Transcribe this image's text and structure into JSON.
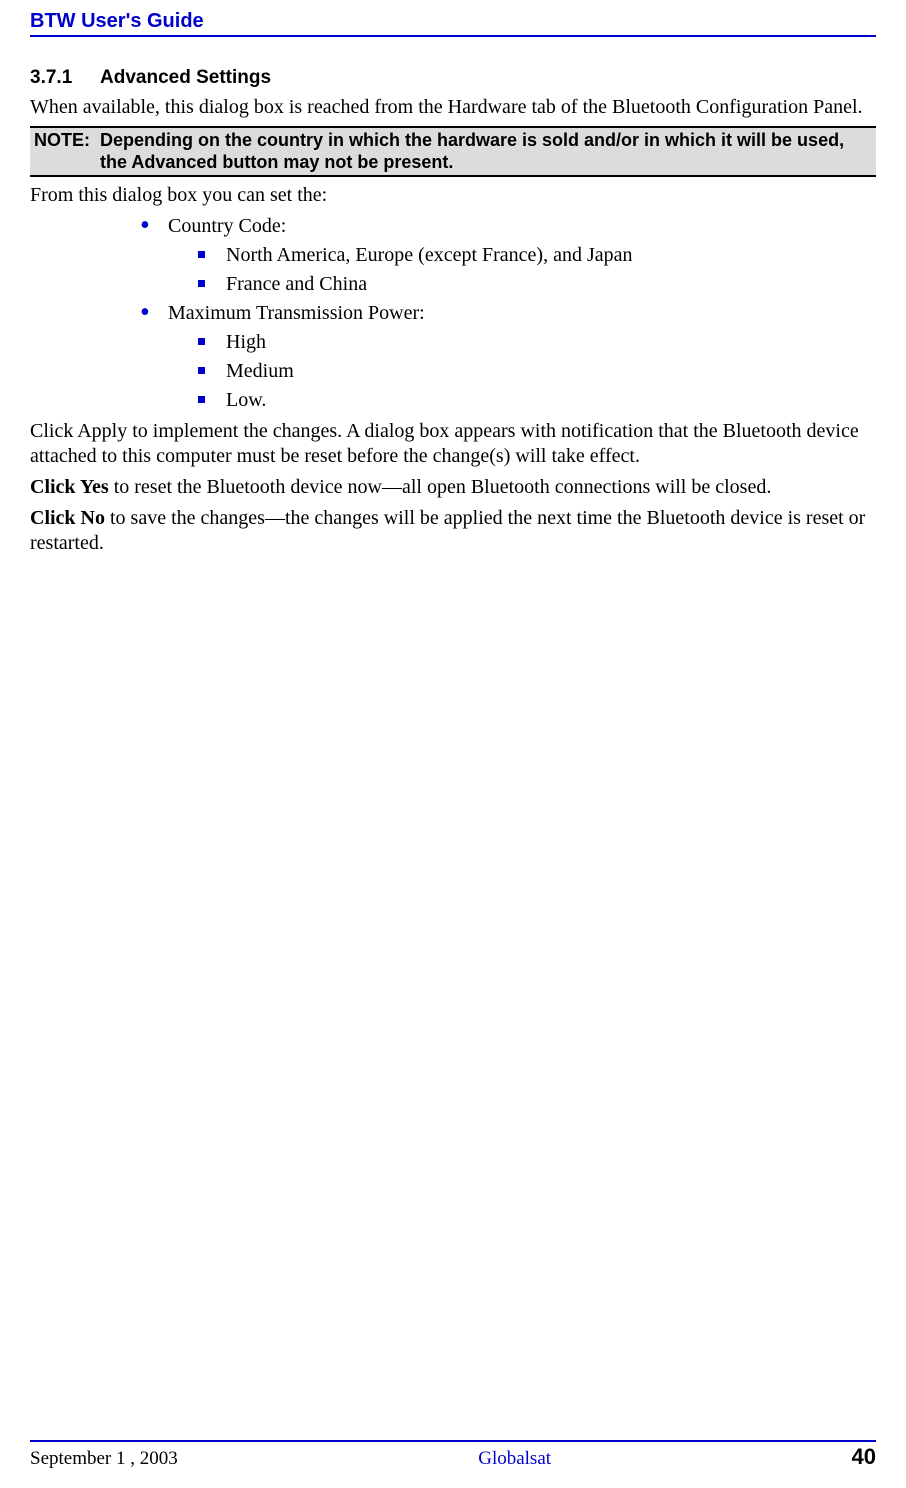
{
  "header": {
    "title": "BTW User's Guide"
  },
  "section": {
    "number": "3.7.1",
    "title": "Advanced Settings",
    "intro": "When available, this dialog box is reached from the Hardware tab of the Bluetooth Configuration Panel."
  },
  "note": {
    "label": "NOTE:",
    "text": "Depending on the country in which the hardware is sold and/or in which it will be used, the Advanced button may not be present."
  },
  "body": {
    "from_text": "From this dialog box you can set the:",
    "items": [
      {
        "label": "Country Code:",
        "sub": [
          "North America, Europe (except France), and Japan",
          "France and China"
        ]
      },
      {
        "label": "Maximum Transmission Power:",
        "sub": [
          "High",
          "Medium",
          "Low."
        ]
      }
    ],
    "apply_para": "Click Apply to implement the changes. A dialog box appears with notification that the Bluetooth device attached to this computer must be reset before the change(s) will take effect.",
    "yes_bold": "Click Yes",
    "yes_rest": " to reset the Bluetooth device now—all open Bluetooth connections will be closed.",
    "no_bold": "Click No",
    "no_rest": " to save the changes—the changes will be applied the next time the Bluetooth device is reset or restarted."
  },
  "footer": {
    "date": "September 1 , 2003",
    "center": "Globalsat",
    "page": "40"
  }
}
